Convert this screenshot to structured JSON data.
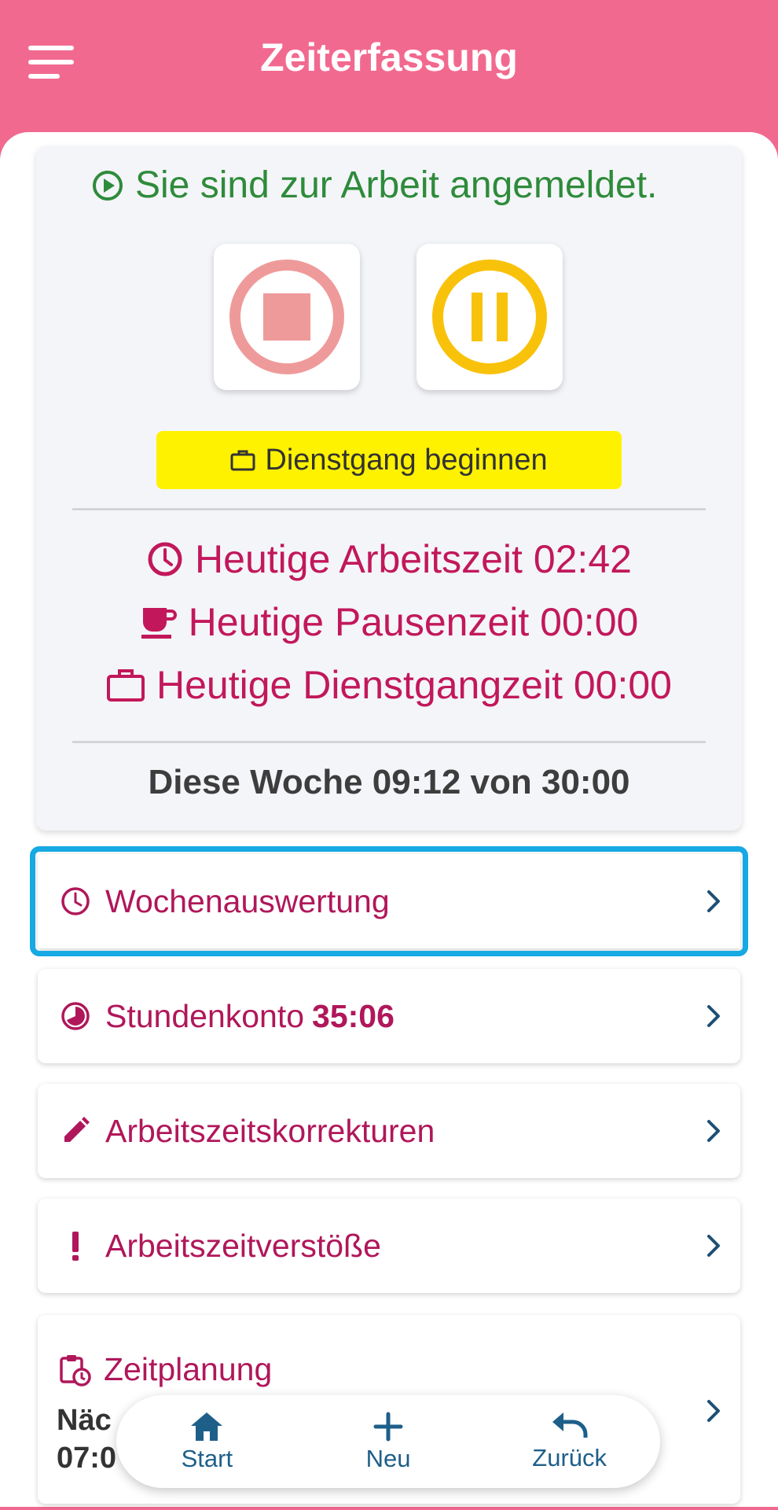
{
  "appbar": {
    "title": "Zeiterfassung"
  },
  "status": {
    "message": "Sie sind zur Arbeit angemeldet.",
    "errand_label": "Dienstgang beginnen"
  },
  "today": {
    "work_label": "Heutige Arbeitszeit 02:42",
    "pause_label": "Heutige Pausenzeit 00:00",
    "errand_label": "Heutige Dienstgangzeit 00:00"
  },
  "week": {
    "summary": "Diese Woche 09:12 von 30:00"
  },
  "menu": {
    "week_eval": "Wochenauswertung",
    "hours_account_label": "Stundenkonto",
    "hours_account_value": "35:06",
    "corrections": "Arbeitszeitskorrekturen",
    "violations": "Arbeitszeitverstöße",
    "planning": "Zeitplanung",
    "planning_next_line1": "Näc",
    "planning_next_line2": "07:0"
  },
  "bottom_nav": {
    "start": "Start",
    "new": "Neu",
    "back": "Zurück"
  },
  "colors": {
    "appbar": "#f2698f",
    "accent_text": "#c2185b",
    "status_green": "#2e8b3a",
    "errand_yellow": "#fff200",
    "selection": "#16a9e3",
    "nav_blue": "#1e5f8a"
  },
  "icons": {
    "menu": "hamburger-icon",
    "status": "play-circle-icon",
    "stop": "stop-circle-icon",
    "pause": "pause-circle-icon",
    "errand": "briefcase-icon",
    "work": "clock-icon",
    "pause_time": "coffee-cup-icon",
    "week_eval": "clock-icon",
    "hours_account": "pie-clock-icon",
    "corrections": "pencil-icon",
    "violations": "exclamation-icon",
    "planning": "calendar-clock-icon",
    "home": "home-icon",
    "new": "plus-icon",
    "back": "undo-icon"
  }
}
